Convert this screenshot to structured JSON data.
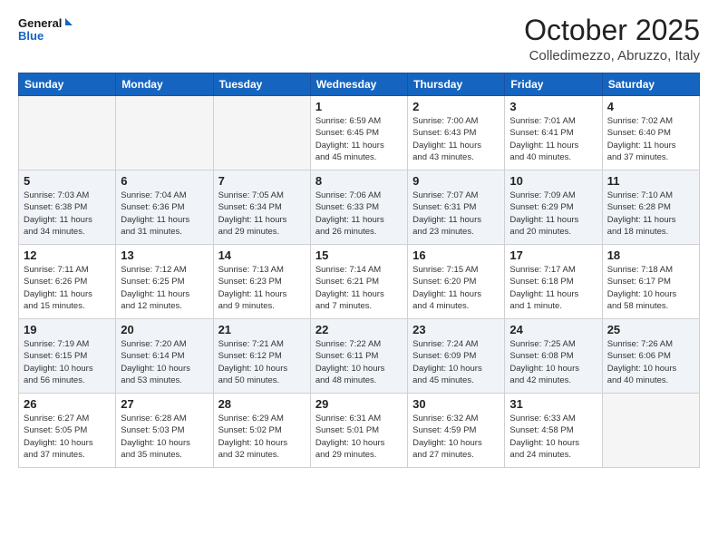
{
  "logo": {
    "text_general": "General",
    "text_blue": "Blue"
  },
  "header": {
    "month": "October 2025",
    "location": "Colledimezzo, Abruzzo, Italy"
  },
  "weekdays": [
    "Sunday",
    "Monday",
    "Tuesday",
    "Wednesday",
    "Thursday",
    "Friday",
    "Saturday"
  ],
  "weeks": [
    [
      {
        "day": "",
        "info": ""
      },
      {
        "day": "",
        "info": ""
      },
      {
        "day": "",
        "info": ""
      },
      {
        "day": "1",
        "info": "Sunrise: 6:59 AM\nSunset: 6:45 PM\nDaylight: 11 hours\nand 45 minutes."
      },
      {
        "day": "2",
        "info": "Sunrise: 7:00 AM\nSunset: 6:43 PM\nDaylight: 11 hours\nand 43 minutes."
      },
      {
        "day": "3",
        "info": "Sunrise: 7:01 AM\nSunset: 6:41 PM\nDaylight: 11 hours\nand 40 minutes."
      },
      {
        "day": "4",
        "info": "Sunrise: 7:02 AM\nSunset: 6:40 PM\nDaylight: 11 hours\nand 37 minutes."
      }
    ],
    [
      {
        "day": "5",
        "info": "Sunrise: 7:03 AM\nSunset: 6:38 PM\nDaylight: 11 hours\nand 34 minutes."
      },
      {
        "day": "6",
        "info": "Sunrise: 7:04 AM\nSunset: 6:36 PM\nDaylight: 11 hours\nand 31 minutes."
      },
      {
        "day": "7",
        "info": "Sunrise: 7:05 AM\nSunset: 6:34 PM\nDaylight: 11 hours\nand 29 minutes."
      },
      {
        "day": "8",
        "info": "Sunrise: 7:06 AM\nSunset: 6:33 PM\nDaylight: 11 hours\nand 26 minutes."
      },
      {
        "day": "9",
        "info": "Sunrise: 7:07 AM\nSunset: 6:31 PM\nDaylight: 11 hours\nand 23 minutes."
      },
      {
        "day": "10",
        "info": "Sunrise: 7:09 AM\nSunset: 6:29 PM\nDaylight: 11 hours\nand 20 minutes."
      },
      {
        "day": "11",
        "info": "Sunrise: 7:10 AM\nSunset: 6:28 PM\nDaylight: 11 hours\nand 18 minutes."
      }
    ],
    [
      {
        "day": "12",
        "info": "Sunrise: 7:11 AM\nSunset: 6:26 PM\nDaylight: 11 hours\nand 15 minutes."
      },
      {
        "day": "13",
        "info": "Sunrise: 7:12 AM\nSunset: 6:25 PM\nDaylight: 11 hours\nand 12 minutes."
      },
      {
        "day": "14",
        "info": "Sunrise: 7:13 AM\nSunset: 6:23 PM\nDaylight: 11 hours\nand 9 minutes."
      },
      {
        "day": "15",
        "info": "Sunrise: 7:14 AM\nSunset: 6:21 PM\nDaylight: 11 hours\nand 7 minutes."
      },
      {
        "day": "16",
        "info": "Sunrise: 7:15 AM\nSunset: 6:20 PM\nDaylight: 11 hours\nand 4 minutes."
      },
      {
        "day": "17",
        "info": "Sunrise: 7:17 AM\nSunset: 6:18 PM\nDaylight: 11 hours\nand 1 minute."
      },
      {
        "day": "18",
        "info": "Sunrise: 7:18 AM\nSunset: 6:17 PM\nDaylight: 10 hours\nand 58 minutes."
      }
    ],
    [
      {
        "day": "19",
        "info": "Sunrise: 7:19 AM\nSunset: 6:15 PM\nDaylight: 10 hours\nand 56 minutes."
      },
      {
        "day": "20",
        "info": "Sunrise: 7:20 AM\nSunset: 6:14 PM\nDaylight: 10 hours\nand 53 minutes."
      },
      {
        "day": "21",
        "info": "Sunrise: 7:21 AM\nSunset: 6:12 PM\nDaylight: 10 hours\nand 50 minutes."
      },
      {
        "day": "22",
        "info": "Sunrise: 7:22 AM\nSunset: 6:11 PM\nDaylight: 10 hours\nand 48 minutes."
      },
      {
        "day": "23",
        "info": "Sunrise: 7:24 AM\nSunset: 6:09 PM\nDaylight: 10 hours\nand 45 minutes."
      },
      {
        "day": "24",
        "info": "Sunrise: 7:25 AM\nSunset: 6:08 PM\nDaylight: 10 hours\nand 42 minutes."
      },
      {
        "day": "25",
        "info": "Sunrise: 7:26 AM\nSunset: 6:06 PM\nDaylight: 10 hours\nand 40 minutes."
      }
    ],
    [
      {
        "day": "26",
        "info": "Sunrise: 6:27 AM\nSunset: 5:05 PM\nDaylight: 10 hours\nand 37 minutes."
      },
      {
        "day": "27",
        "info": "Sunrise: 6:28 AM\nSunset: 5:03 PM\nDaylight: 10 hours\nand 35 minutes."
      },
      {
        "day": "28",
        "info": "Sunrise: 6:29 AM\nSunset: 5:02 PM\nDaylight: 10 hours\nand 32 minutes."
      },
      {
        "day": "29",
        "info": "Sunrise: 6:31 AM\nSunset: 5:01 PM\nDaylight: 10 hours\nand 29 minutes."
      },
      {
        "day": "30",
        "info": "Sunrise: 6:32 AM\nSunset: 4:59 PM\nDaylight: 10 hours\nand 27 minutes."
      },
      {
        "day": "31",
        "info": "Sunrise: 6:33 AM\nSunset: 4:58 PM\nDaylight: 10 hours\nand 24 minutes."
      },
      {
        "day": "",
        "info": ""
      }
    ]
  ]
}
